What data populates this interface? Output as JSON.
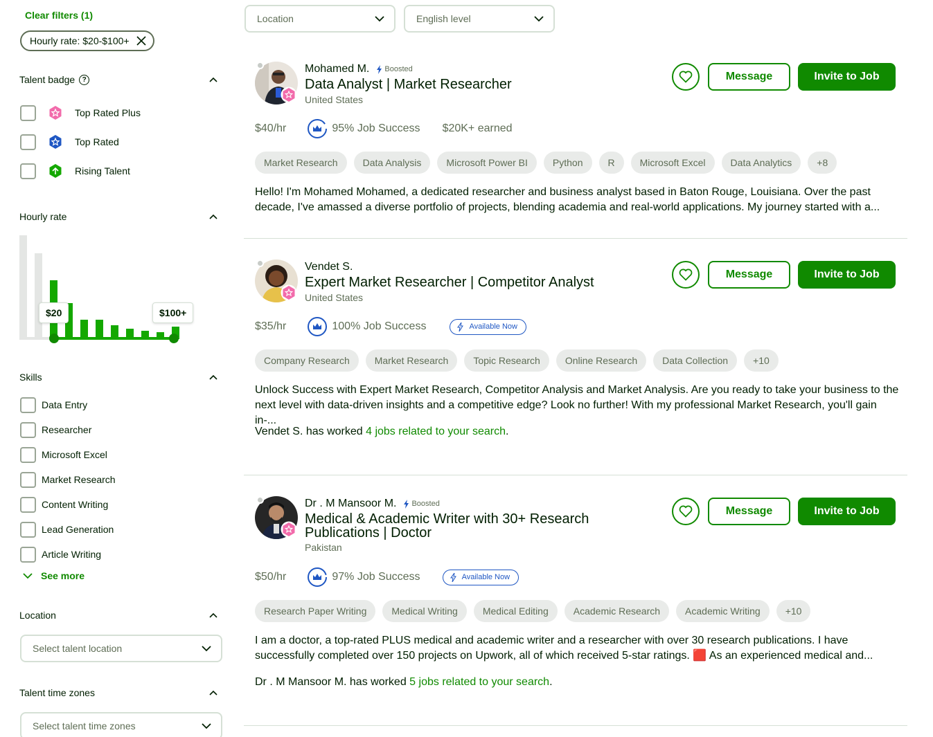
{
  "filters": {
    "clear_label": "Clear filters (1)",
    "active_chip": "Hourly rate: $20-$100+"
  },
  "talent_badge": {
    "title": "Talent badge",
    "items": [
      {
        "label": "Top Rated Plus",
        "color": "#f26bab"
      },
      {
        "label": "Top Rated",
        "color": "#1f57c3"
      },
      {
        "label": "Rising Talent",
        "color": "#14a800"
      }
    ]
  },
  "hourly_rate": {
    "title": "Hourly rate",
    "min_label": "$20",
    "max_label": "$100+",
    "selected_min_fraction": 0.19,
    "selected_max_fraction": 0.87
  },
  "skills": {
    "title": "Skills",
    "items": [
      "Data Entry",
      "Researcher",
      "Microsoft Excel",
      "Market Research",
      "Content Writing",
      "Lead Generation",
      "Article Writing"
    ],
    "see_more": "See more"
  },
  "location": {
    "title": "Location",
    "placeholder": "Select talent location"
  },
  "time_zones": {
    "title": "Talent time zones",
    "placeholder": "Select talent time zones"
  },
  "top_filters": {
    "location": "Location",
    "english": "English level"
  },
  "actions": {
    "message": "Message",
    "invite": "Invite to Job"
  },
  "freelancers": [
    {
      "name": "Mohamed M.",
      "boosted": "Boosted",
      "title": "Data Analyst | Market Researcher",
      "country": "United States",
      "rate": "$40/hr",
      "job_success": "95% Job Success",
      "earned": "$20K+ earned",
      "skills": [
        "Market Research",
        "Data Analysis",
        "Microsoft Power BI",
        "Python",
        "R",
        "Microsoft Excel",
        "Data Analytics",
        "+8"
      ],
      "description": "Hello! I'm Mohamed Mohamed, a dedicated researcher and business analyst based in Baton Rouge, Louisiana. Over the past decade, I've amassed a diverse portfolio of projects, blending academia and real-world applications. My journey started with a..."
    },
    {
      "name": "Vendet S.",
      "title": "Expert Market Researcher | Competitor Analyst",
      "country": "United States",
      "rate": "$35/hr",
      "job_success": "100% Job Success",
      "available": "Available Now",
      "skills": [
        "Company Research",
        "Market Research",
        "Topic Research",
        "Online Research",
        "Data Collection",
        "+10"
      ],
      "description": "Unlock Success with Expert Market Research, Competitor Analysis and Market Analysis. Are you ready to take your business to the next level with data-driven insights and a competitive edge? Look no further! With my professional Market Research, you'll gain in-...",
      "worked_prefix": "Vendet S. has worked ",
      "worked_link": "4 jobs related to your search",
      "worked_suffix": "."
    },
    {
      "name": "Dr . M Mansoor M.",
      "boosted": "Boosted",
      "title_line1": "Medical & Academic Writer with 30+ Research",
      "title_line2": "Publications | Doctor",
      "country": "Pakistan",
      "rate": "$50/hr",
      "job_success": "97% Job Success",
      "available": "Available Now",
      "skills": [
        "Research Paper Writing",
        "Medical Writing",
        "Medical Editing",
        "Academic Research",
        "Academic Writing",
        "+10"
      ],
      "description_line1": "I am a doctor, a top-rated PLUS medical and academic writer and a researcher with over 30 research publications. I have",
      "description_line2": "successfully completed over 150 projects on Upwork, all of which received 5-star ratings. 🟥 As an experienced medical and...",
      "worked_prefix": "Dr . M Mansoor M. has worked ",
      "worked_link": "5 jobs related to your search",
      "worked_suffix": "."
    }
  ]
}
